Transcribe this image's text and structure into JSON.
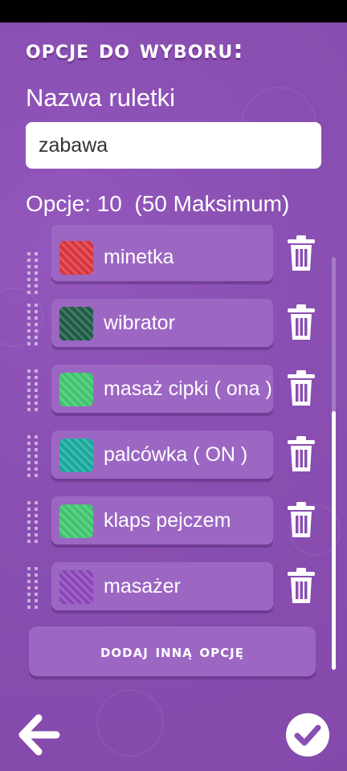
{
  "header": {
    "title": "Opcje do wyboru:"
  },
  "roulette": {
    "name_label": "Nazwa ruletki",
    "name_value": "zabawa"
  },
  "options_count": {
    "label": "Opcje: 10  (50 Maksimum)"
  },
  "options": [
    {
      "label": "minetka",
      "color": "#d8343c",
      "icon": "trash-icon"
    },
    {
      "label": "wibrator",
      "color": "#1d5a45",
      "icon": "trash-icon"
    },
    {
      "label": "masaż cipki ( ona )",
      "color": "#3fc36e",
      "icon": "trash-icon"
    },
    {
      "label": "palcówka ( ON )",
      "color": "#17a89c",
      "icon": "trash-icon"
    },
    {
      "label": "klaps pejczem",
      "color": "#3fc36e",
      "icon": "trash-icon"
    },
    {
      "label": "masażer",
      "color": "#8a45b8",
      "icon": "trash-icon"
    }
  ],
  "actions": {
    "add_option_label": "Dodaj inną opcję",
    "back_icon": "arrow-left-icon",
    "confirm_icon": "checkmark-icon"
  },
  "colors": {
    "background": "#8a4fb2",
    "card": "#9c66c3",
    "text": "#ffffff"
  }
}
